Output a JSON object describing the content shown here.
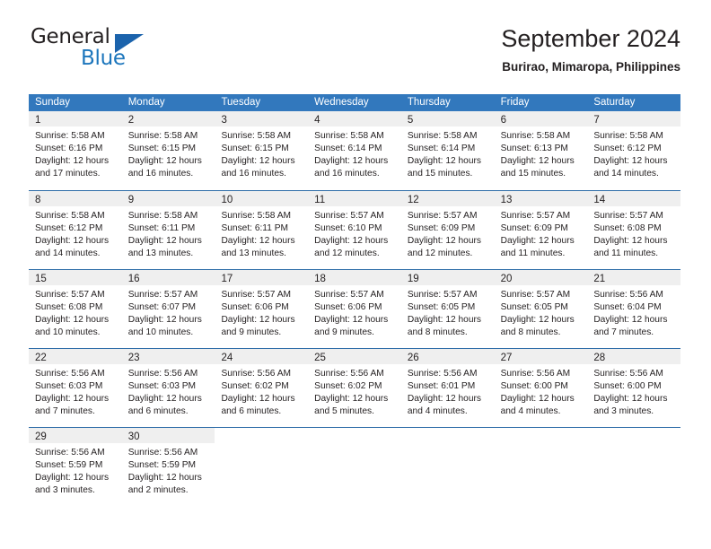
{
  "brand": {
    "word_general": "General",
    "word_blue": "Blue",
    "accent_color": "#1b75bc"
  },
  "header": {
    "title": "September 2024",
    "location": "Burirao, Mimaropa, Philippines"
  },
  "theme": {
    "header_blue": "#3278bd",
    "row_divider_blue": "#2e6da8",
    "date_band_gray": "#efefef"
  },
  "weekday_headers": [
    "Sunday",
    "Monday",
    "Tuesday",
    "Wednesday",
    "Thursday",
    "Friday",
    "Saturday"
  ],
  "weeks": [
    [
      {
        "day": "1",
        "sunrise": "Sunrise: 5:58 AM",
        "sunset": "Sunset: 6:16 PM",
        "daylight1": "Daylight: 12 hours",
        "daylight2": "and 17 minutes."
      },
      {
        "day": "2",
        "sunrise": "Sunrise: 5:58 AM",
        "sunset": "Sunset: 6:15 PM",
        "daylight1": "Daylight: 12 hours",
        "daylight2": "and 16 minutes."
      },
      {
        "day": "3",
        "sunrise": "Sunrise: 5:58 AM",
        "sunset": "Sunset: 6:15 PM",
        "daylight1": "Daylight: 12 hours",
        "daylight2": "and 16 minutes."
      },
      {
        "day": "4",
        "sunrise": "Sunrise: 5:58 AM",
        "sunset": "Sunset: 6:14 PM",
        "daylight1": "Daylight: 12 hours",
        "daylight2": "and 16 minutes."
      },
      {
        "day": "5",
        "sunrise": "Sunrise: 5:58 AM",
        "sunset": "Sunset: 6:14 PM",
        "daylight1": "Daylight: 12 hours",
        "daylight2": "and 15 minutes."
      },
      {
        "day": "6",
        "sunrise": "Sunrise: 5:58 AM",
        "sunset": "Sunset: 6:13 PM",
        "daylight1": "Daylight: 12 hours",
        "daylight2": "and 15 minutes."
      },
      {
        "day": "7",
        "sunrise": "Sunrise: 5:58 AM",
        "sunset": "Sunset: 6:12 PM",
        "daylight1": "Daylight: 12 hours",
        "daylight2": "and 14 minutes."
      }
    ],
    [
      {
        "day": "8",
        "sunrise": "Sunrise: 5:58 AM",
        "sunset": "Sunset: 6:12 PM",
        "daylight1": "Daylight: 12 hours",
        "daylight2": "and 14 minutes."
      },
      {
        "day": "9",
        "sunrise": "Sunrise: 5:58 AM",
        "sunset": "Sunset: 6:11 PM",
        "daylight1": "Daylight: 12 hours",
        "daylight2": "and 13 minutes."
      },
      {
        "day": "10",
        "sunrise": "Sunrise: 5:58 AM",
        "sunset": "Sunset: 6:11 PM",
        "daylight1": "Daylight: 12 hours",
        "daylight2": "and 13 minutes."
      },
      {
        "day": "11",
        "sunrise": "Sunrise: 5:57 AM",
        "sunset": "Sunset: 6:10 PM",
        "daylight1": "Daylight: 12 hours",
        "daylight2": "and 12 minutes."
      },
      {
        "day": "12",
        "sunrise": "Sunrise: 5:57 AM",
        "sunset": "Sunset: 6:09 PM",
        "daylight1": "Daylight: 12 hours",
        "daylight2": "and 12 minutes."
      },
      {
        "day": "13",
        "sunrise": "Sunrise: 5:57 AM",
        "sunset": "Sunset: 6:09 PM",
        "daylight1": "Daylight: 12 hours",
        "daylight2": "and 11 minutes."
      },
      {
        "day": "14",
        "sunrise": "Sunrise: 5:57 AM",
        "sunset": "Sunset: 6:08 PM",
        "daylight1": "Daylight: 12 hours",
        "daylight2": "and 11 minutes."
      }
    ],
    [
      {
        "day": "15",
        "sunrise": "Sunrise: 5:57 AM",
        "sunset": "Sunset: 6:08 PM",
        "daylight1": "Daylight: 12 hours",
        "daylight2": "and 10 minutes."
      },
      {
        "day": "16",
        "sunrise": "Sunrise: 5:57 AM",
        "sunset": "Sunset: 6:07 PM",
        "daylight1": "Daylight: 12 hours",
        "daylight2": "and 10 minutes."
      },
      {
        "day": "17",
        "sunrise": "Sunrise: 5:57 AM",
        "sunset": "Sunset: 6:06 PM",
        "daylight1": "Daylight: 12 hours",
        "daylight2": "and 9 minutes."
      },
      {
        "day": "18",
        "sunrise": "Sunrise: 5:57 AM",
        "sunset": "Sunset: 6:06 PM",
        "daylight1": "Daylight: 12 hours",
        "daylight2": "and 9 minutes."
      },
      {
        "day": "19",
        "sunrise": "Sunrise: 5:57 AM",
        "sunset": "Sunset: 6:05 PM",
        "daylight1": "Daylight: 12 hours",
        "daylight2": "and 8 minutes."
      },
      {
        "day": "20",
        "sunrise": "Sunrise: 5:57 AM",
        "sunset": "Sunset: 6:05 PM",
        "daylight1": "Daylight: 12 hours",
        "daylight2": "and 8 minutes."
      },
      {
        "day": "21",
        "sunrise": "Sunrise: 5:56 AM",
        "sunset": "Sunset: 6:04 PM",
        "daylight1": "Daylight: 12 hours",
        "daylight2": "and 7 minutes."
      }
    ],
    [
      {
        "day": "22",
        "sunrise": "Sunrise: 5:56 AM",
        "sunset": "Sunset: 6:03 PM",
        "daylight1": "Daylight: 12 hours",
        "daylight2": "and 7 minutes."
      },
      {
        "day": "23",
        "sunrise": "Sunrise: 5:56 AM",
        "sunset": "Sunset: 6:03 PM",
        "daylight1": "Daylight: 12 hours",
        "daylight2": "and 6 minutes."
      },
      {
        "day": "24",
        "sunrise": "Sunrise: 5:56 AM",
        "sunset": "Sunset: 6:02 PM",
        "daylight1": "Daylight: 12 hours",
        "daylight2": "and 6 minutes."
      },
      {
        "day": "25",
        "sunrise": "Sunrise: 5:56 AM",
        "sunset": "Sunset: 6:02 PM",
        "daylight1": "Daylight: 12 hours",
        "daylight2": "and 5 minutes."
      },
      {
        "day": "26",
        "sunrise": "Sunrise: 5:56 AM",
        "sunset": "Sunset: 6:01 PM",
        "daylight1": "Daylight: 12 hours",
        "daylight2": "and 4 minutes."
      },
      {
        "day": "27",
        "sunrise": "Sunrise: 5:56 AM",
        "sunset": "Sunset: 6:00 PM",
        "daylight1": "Daylight: 12 hours",
        "daylight2": "and 4 minutes."
      },
      {
        "day": "28",
        "sunrise": "Sunrise: 5:56 AM",
        "sunset": "Sunset: 6:00 PM",
        "daylight1": "Daylight: 12 hours",
        "daylight2": "and 3 minutes."
      }
    ],
    [
      {
        "day": "29",
        "sunrise": "Sunrise: 5:56 AM",
        "sunset": "Sunset: 5:59 PM",
        "daylight1": "Daylight: 12 hours",
        "daylight2": "and 3 minutes."
      },
      {
        "day": "30",
        "sunrise": "Sunrise: 5:56 AM",
        "sunset": "Sunset: 5:59 PM",
        "daylight1": "Daylight: 12 hours",
        "daylight2": "and 2 minutes."
      },
      {
        "day": "",
        "sunrise": "",
        "sunset": "",
        "daylight1": "",
        "daylight2": ""
      },
      {
        "day": "",
        "sunrise": "",
        "sunset": "",
        "daylight1": "",
        "daylight2": ""
      },
      {
        "day": "",
        "sunrise": "",
        "sunset": "",
        "daylight1": "",
        "daylight2": ""
      },
      {
        "day": "",
        "sunrise": "",
        "sunset": "",
        "daylight1": "",
        "daylight2": ""
      },
      {
        "day": "",
        "sunrise": "",
        "sunset": "",
        "daylight1": "",
        "daylight2": ""
      }
    ]
  ]
}
